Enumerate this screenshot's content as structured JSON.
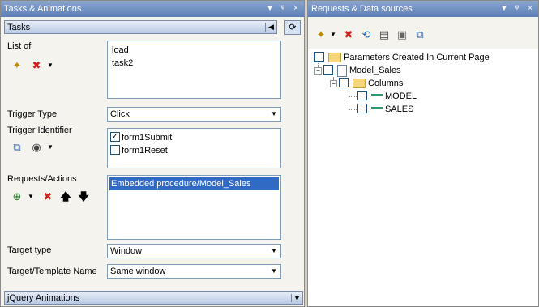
{
  "left_panel": {
    "title": "Tasks & Animations",
    "title_buttons": [
      "▼",
      "ᵠ",
      "×"
    ],
    "tasks_combo": "Tasks",
    "list_of_label": "List of",
    "tasks_list": [
      "load",
      "task2"
    ],
    "trigger_type_label": "Trigger Type",
    "trigger_type_value": "Click",
    "trigger_identifier_label": "Trigger Identifier",
    "trigger_identifiers": [
      {
        "label": "form1Submit",
        "checked": true
      },
      {
        "label": "form1Reset",
        "checked": false
      }
    ],
    "requests_actions_label": "Requests/Actions",
    "requests_actions": [
      "Embedded procedure/Model_Sales"
    ],
    "target_type_label": "Target type",
    "target_type_value": "Window",
    "target_template_label": "Target/Template Name",
    "target_template_value": "Same window",
    "jquery_combo": "jQuery Animations"
  },
  "right_panel": {
    "title": "Requests & Data sources",
    "tree": {
      "params": "Parameters Created In Current Page",
      "model_sales": "Model_Sales",
      "columns": "Columns",
      "fields": [
        "MODEL",
        "SALES"
      ]
    }
  },
  "colors": {
    "title_bar": "#6f8fc3",
    "selection": "#316ac5",
    "input_border": "#7f9db9"
  }
}
